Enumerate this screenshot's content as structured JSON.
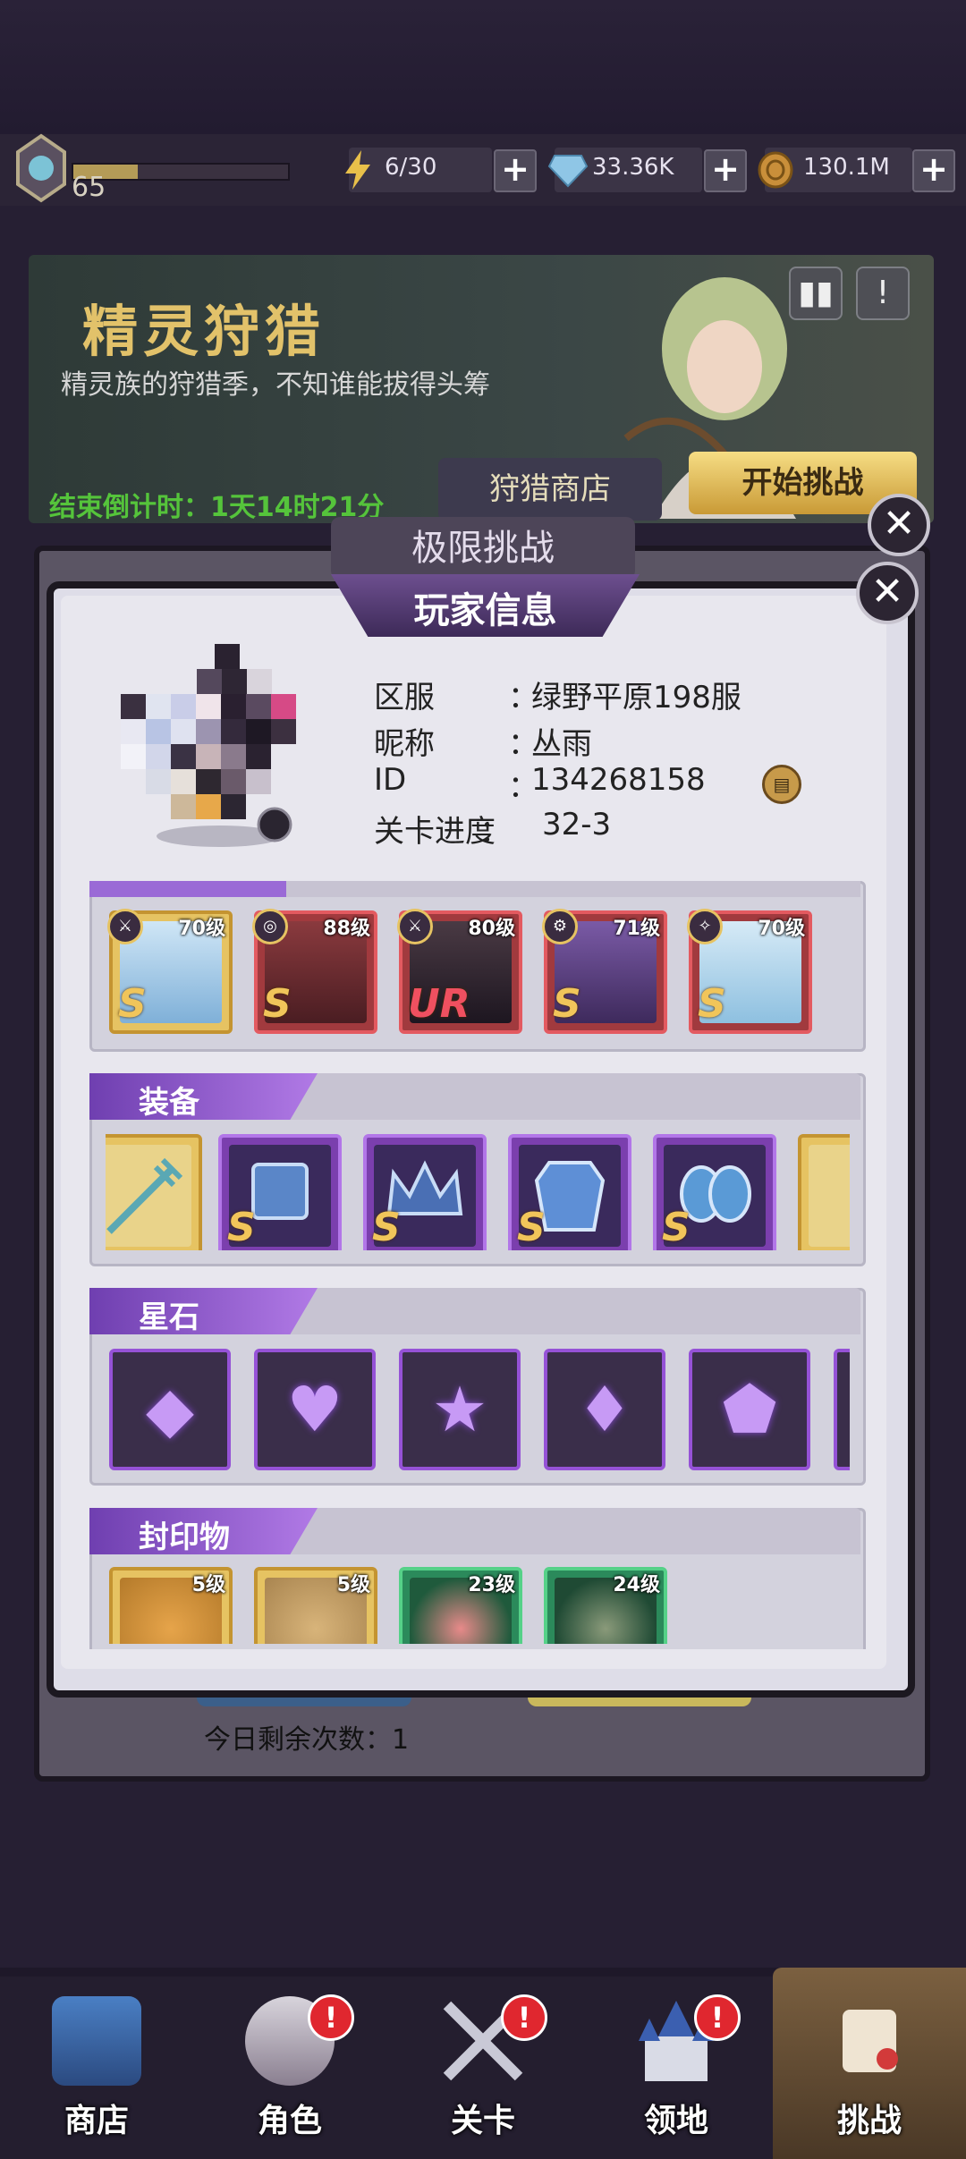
{
  "player": {
    "level": "65",
    "exp_fraction": 0.3
  },
  "resources": [
    {
      "icon": "energy-icon",
      "value": "6/30"
    },
    {
      "icon": "diamond-icon",
      "value": "33.36K"
    },
    {
      "icon": "coin-icon",
      "value": "130.1M"
    }
  ],
  "event": {
    "title": "精灵狩猎",
    "subtitle": "精灵族的狩猎季，不知谁能拔得头筹",
    "countdown": "结束倒计时：1天14时21分",
    "shop_button": "狩猎商店",
    "start_button": "开始挑战",
    "rank_icon": "▮▮",
    "info_icon": "!"
  },
  "back_panel": {
    "title": "极限挑战",
    "remaining": "今日剩余次数：1",
    "close": "✕"
  },
  "modal": {
    "title": "玩家信息",
    "close": "✕",
    "info": [
      {
        "label": "区服",
        "value": "绿野平原198服"
      },
      {
        "label": "昵称",
        "value": "丛雨"
      },
      {
        "label": "ID",
        "value": "134268158"
      },
      {
        "label": "关卡进度",
        "value": "32-3"
      }
    ],
    "separator": "：",
    "copy_icon": "▤"
  },
  "heroes": [
    {
      "level": "70级",
      "rank": "S",
      "frame": "gold"
    },
    {
      "level": "88级",
      "rank": "S",
      "frame": "red"
    },
    {
      "level": "80级",
      "rank": "UR",
      "frame": "red"
    },
    {
      "level": "71级",
      "rank": "S",
      "frame": "red"
    },
    {
      "level": "70级",
      "rank": "S",
      "frame": "red"
    }
  ],
  "equipment": {
    "title": "装备",
    "items": [
      {
        "rank": "",
        "frame": "gold"
      },
      {
        "rank": "S",
        "frame": "purple"
      },
      {
        "rank": "S",
        "frame": "purple"
      },
      {
        "rank": "S",
        "frame": "purple"
      },
      {
        "rank": "S",
        "frame": "purple"
      },
      {
        "rank": "",
        "frame": "gold"
      }
    ]
  },
  "stones": {
    "title": "星石",
    "items": [
      {
        "glyph": "◆",
        "icon": "square-gem-icon"
      },
      {
        "glyph": "♥",
        "icon": "heart-gem-icon"
      },
      {
        "glyph": "★",
        "icon": "star-gem-icon"
      },
      {
        "glyph": "♦",
        "icon": "diamond-gem-icon"
      },
      {
        "glyph": "⬟",
        "icon": "pentagon-gem-icon"
      }
    ]
  },
  "seals": {
    "title": "封印物",
    "items": [
      {
        "level": "5级",
        "frame": "gold"
      },
      {
        "level": "5级",
        "frame": "gold"
      },
      {
        "level": "23级",
        "frame": "green"
      },
      {
        "level": "24级",
        "frame": "green"
      }
    ]
  },
  "nav": [
    {
      "label": "商店",
      "badge": ""
    },
    {
      "label": "角色",
      "badge": "!"
    },
    {
      "label": "关卡",
      "badge": "!"
    },
    {
      "label": "领地",
      "badge": "!"
    },
    {
      "label": "挑战",
      "badge": ""
    }
  ]
}
